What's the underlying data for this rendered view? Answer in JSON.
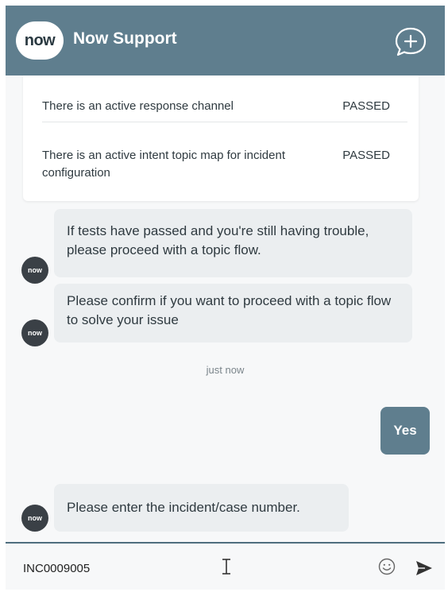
{
  "header": {
    "logo_text": "now",
    "title": "Now Support",
    "new_chat_icon": "chat-plus-icon"
  },
  "checks": [
    {
      "name": "There is an active response channel",
      "result": "PASSED"
    },
    {
      "name": "There is an active intent topic map for incident configuration",
      "result": "PASSED"
    }
  ],
  "messages": {
    "bot_avatar_text": "now",
    "m1": "If tests have passed and you're still having trouble, please proceed with a topic flow.",
    "m2": "Please confirm if you want to proceed with a topic flow to solve your issue",
    "timestamp": "just now",
    "user_reply": "Yes",
    "m3": "Please enter the incident/case number."
  },
  "input": {
    "value": "INC0009005",
    "emoji_icon": "emoji-icon",
    "send_icon": "send-icon"
  },
  "colors": {
    "header_bg": "#5f7e8e",
    "user_bubble": "#5f7e8e",
    "bot_bubble": "#ebeef0",
    "bot_avatar": "#3a4046"
  }
}
